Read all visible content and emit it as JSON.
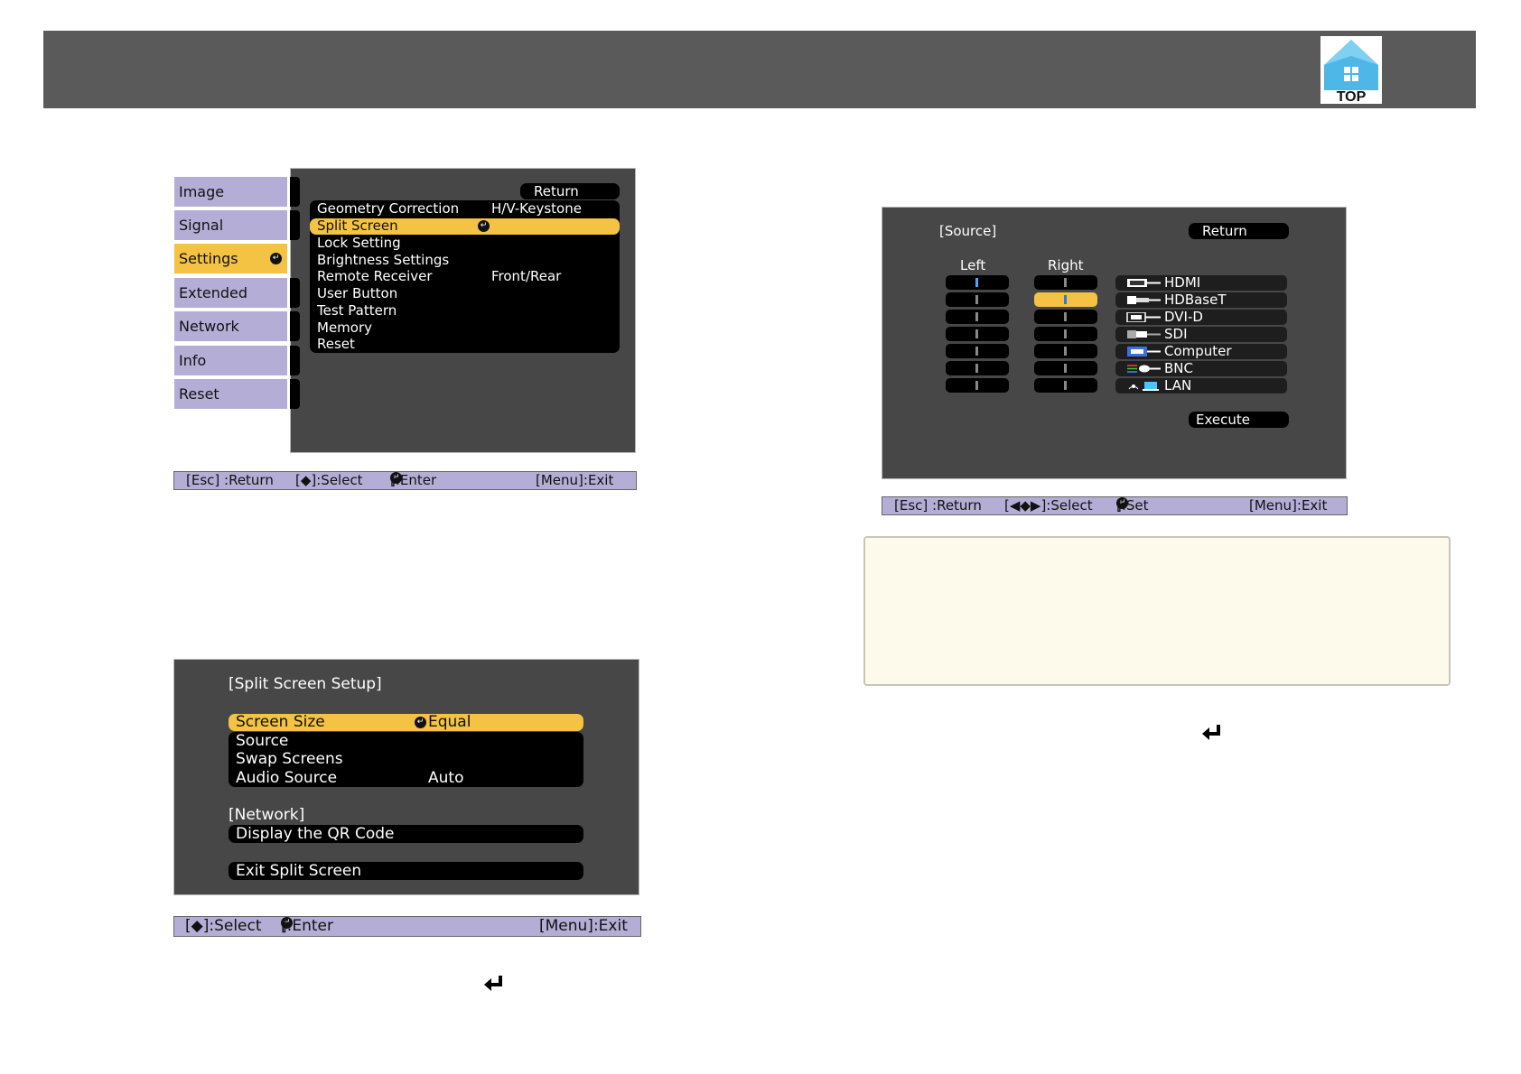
{
  "header": {
    "logo_text": "TOP"
  },
  "settings_menu": {
    "tabs": [
      "Image",
      "Signal",
      "Settings",
      "Extended",
      "Network",
      "Info",
      "Reset"
    ],
    "selected_tab": "Settings",
    "return_label": "Return",
    "rows": [
      {
        "label": "Geometry Correction",
        "value": "H/V-Keystone"
      },
      {
        "label": "Split Screen",
        "value": ""
      },
      {
        "label": "Lock Setting",
        "value": ""
      },
      {
        "label": "Brightness Settings",
        "value": ""
      },
      {
        "label": "Remote Receiver",
        "value": "Front/Rear"
      },
      {
        "label": "User Button",
        "value": ""
      },
      {
        "label": "Test Pattern",
        "value": ""
      },
      {
        "label": "Memory",
        "value": ""
      },
      {
        "label": "Reset",
        "value": ""
      }
    ],
    "highlighted_row": "Split Screen",
    "status": {
      "esc": "[Esc] :Return",
      "select": "[◆]:Select",
      "enter_pre": "[",
      "enter_post": "]:Enter",
      "menu": "[Menu]:Exit"
    }
  },
  "split_screen_setup": {
    "title": "[Split Screen Setup]",
    "rows": [
      {
        "label": "Screen Size",
        "value": "Equal"
      },
      {
        "label": "Source",
        "value": ""
      },
      {
        "label": "Swap Screens",
        "value": ""
      },
      {
        "label": "Audio Source",
        "value": "Auto"
      }
    ],
    "network_heading": "[Network]",
    "network_row": "Display the QR Code",
    "exit_row": "Exit Split Screen",
    "status": {
      "select": "[◆]:Select",
      "enter_pre": "[",
      "enter_post": "]:Enter",
      "menu": "[Menu]:Exit"
    }
  },
  "source_screen": {
    "title": "[Source]",
    "return_label": "Return",
    "left_header": "Left",
    "right_header": "Right",
    "sources": [
      "HDMI",
      "HDBaseT",
      "DVI-D",
      "SDI",
      "Computer",
      "BNC",
      "LAN"
    ],
    "left_selected": "HDMI",
    "right_selected": "HDBaseT",
    "execute_label": "Execute",
    "status": {
      "esc": "[Esc] :Return",
      "select": "[◀◆▶]:Select",
      "set_pre": "[",
      "set_post": "]:Set",
      "menu": "[Menu]:Exit"
    }
  },
  "colors": {
    "header_bg": "#5a5a5a",
    "menu_tab": "#b4aed6",
    "highlight": "#f5c343",
    "panel_bg": "#474747",
    "note_bg": "#fefaeb"
  },
  "icons": [
    "top-logo-icon",
    "enter-icon",
    "return-arrow-icon"
  ]
}
